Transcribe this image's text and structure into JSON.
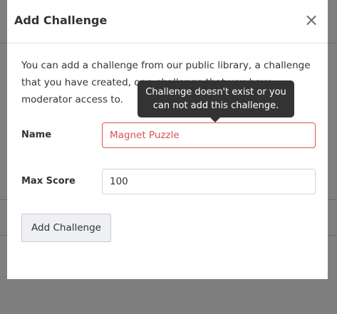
{
  "modal": {
    "title": "Add Challenge",
    "close_symbol": "×",
    "intro_text": "You can add a challenge from our public library, a challenge that you have created, or a challenge that you have moderator access to.",
    "tooltip_text": "Challenge doesn't exist or you can not add this challenge.",
    "fields": {
      "name": {
        "label": "Name",
        "value": "Magnet Puzzle",
        "state": "error"
      },
      "max_score": {
        "label": "Max Score",
        "value": "100"
      }
    },
    "submit_label": "Add Challenge"
  },
  "colors": {
    "error": "#d9534f",
    "tooltip_bg": "#333333",
    "overlay": "#7f7f7f"
  },
  "icons": {
    "close": "close-icon"
  }
}
